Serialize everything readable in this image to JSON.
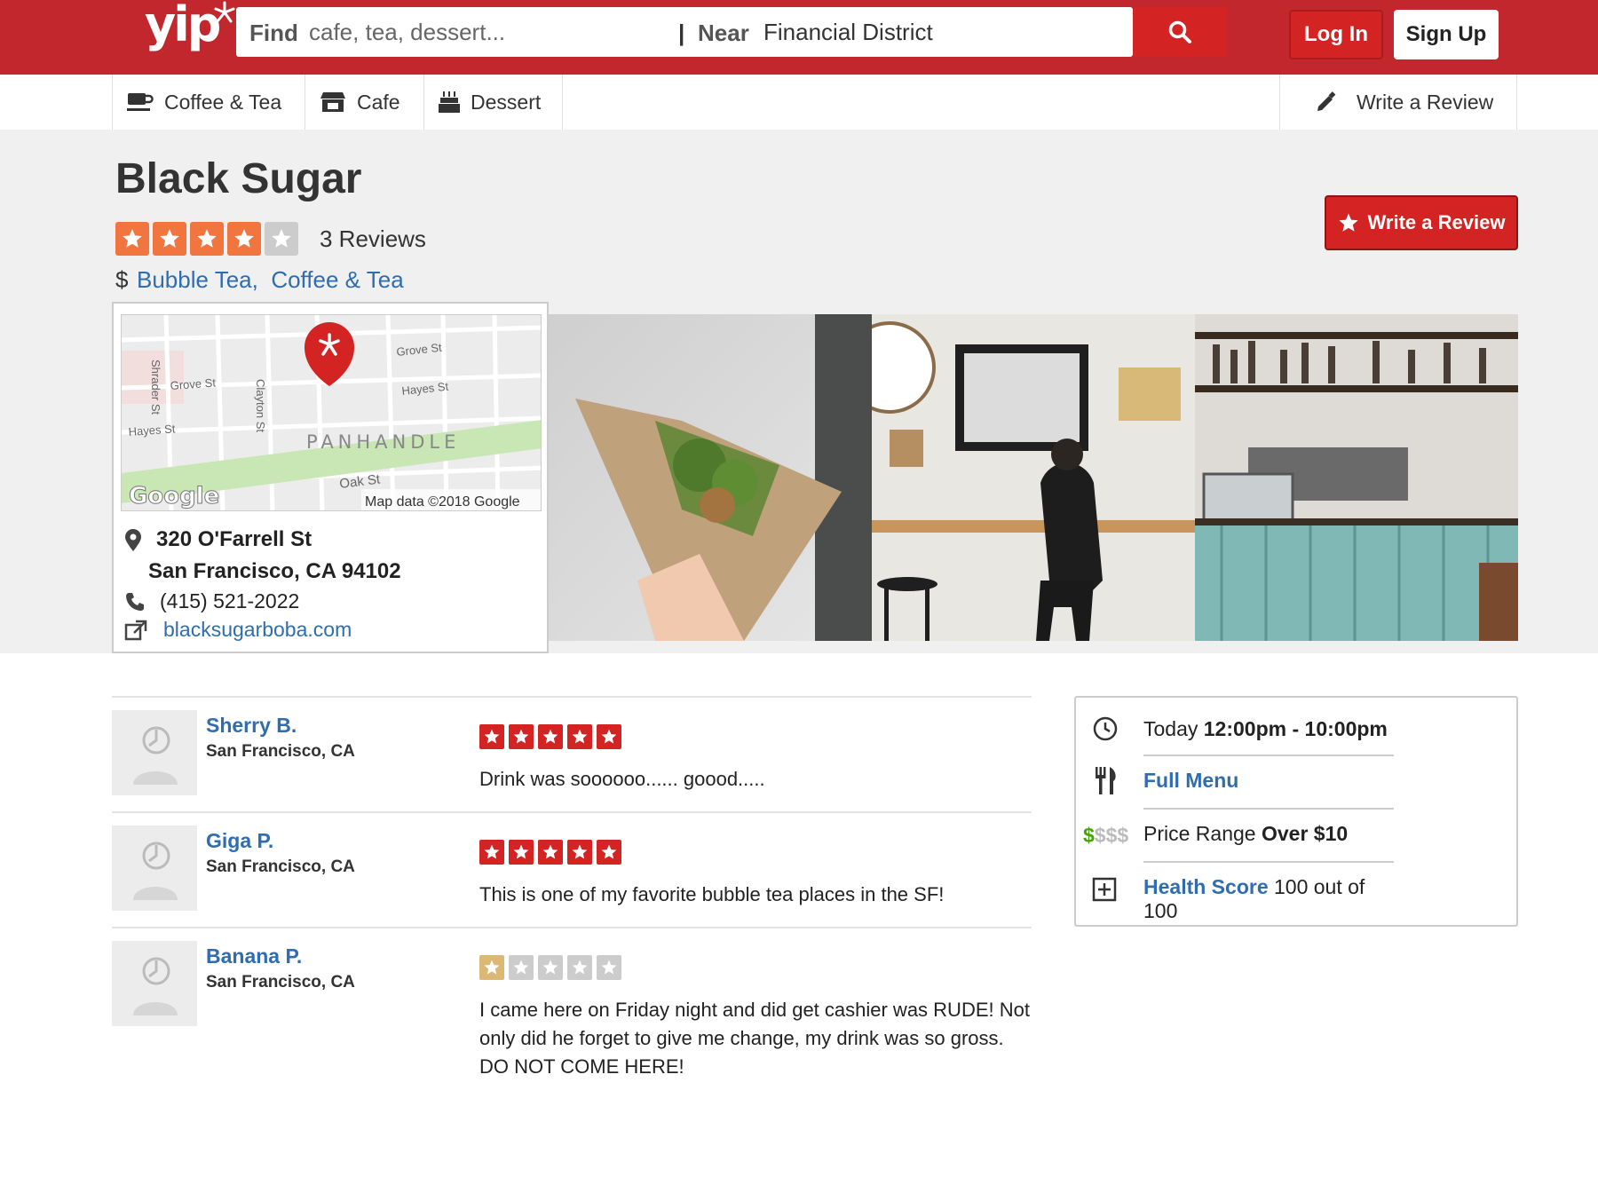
{
  "header": {
    "logo_text": "yip",
    "find_label": "Find",
    "find_placeholder": "cafe, tea, dessert...",
    "separator": "|",
    "near_label": "Near",
    "near_value": "Financial District",
    "login_label": "Log In",
    "signup_label": "Sign Up",
    "brand_color": "#c1272d"
  },
  "subnav": {
    "items": [
      {
        "label": "Coffee & Tea",
        "icon": "coffee-cup-icon"
      },
      {
        "label": "Cafe",
        "icon": "storefront-icon"
      },
      {
        "label": "Dessert",
        "icon": "birthday-cake-icon"
      }
    ],
    "write_review_label": "Write a Review"
  },
  "business": {
    "name": "Black Sugar",
    "rating": 4,
    "rating_max": 5,
    "review_count_text": "3 Reviews",
    "price": "$",
    "categories": [
      "Bubble Tea,",
      "Coffee & Tea"
    ],
    "write_review_button": "Write a Review",
    "address_line1": "320 O'Farrell St",
    "address_line2": "San Francisco, CA 94102",
    "phone": "(415) 521-2022",
    "website": "blacksugarboba.com",
    "map": {
      "streets": [
        "Grove St",
        "Hayes St",
        "Shrader St",
        "Grove St",
        "Clayton St",
        "Hayes St",
        "Oak St"
      ],
      "area_label": "PANHANDLE",
      "google_label": "Google",
      "attribution": "Map data ©2018 Google"
    },
    "photos": [
      "wrap-photo",
      "cafe-customer-photo",
      "cafe-counter-photo"
    ]
  },
  "reviews": [
    {
      "name": "Sherry B.",
      "location": "San Francisco, CA",
      "rating": 5,
      "text": "Drink was soooooo...... goood....."
    },
    {
      "name": "Giga P.",
      "location": "San Francisco, CA",
      "rating": 5,
      "text": "This is one of my favorite bubble tea places in the SF!"
    },
    {
      "name": "Banana P.",
      "location": "San Francisco, CA",
      "rating": 1,
      "text": "I came here on Friday night and did get cashier was RUDE! Not only did he forget to give me change, my drink was so gross. DO NOT COME HERE!"
    }
  ],
  "info": {
    "hours_prefix": "Today",
    "hours_value": "12:00pm - 10:00pm",
    "menu_label": "Full Menu",
    "price_symbols": "$$$$",
    "price_prefix": "Price Range",
    "price_value": "Over $10",
    "health_label": "Health Score",
    "health_value": "100 out of 100"
  },
  "colors": {
    "biz_star": "#f1753f",
    "review_star_red": "#d32323",
    "review_star_low": "#dcb875",
    "star_empty": "#cccccc",
    "link": "#2f6db0"
  }
}
